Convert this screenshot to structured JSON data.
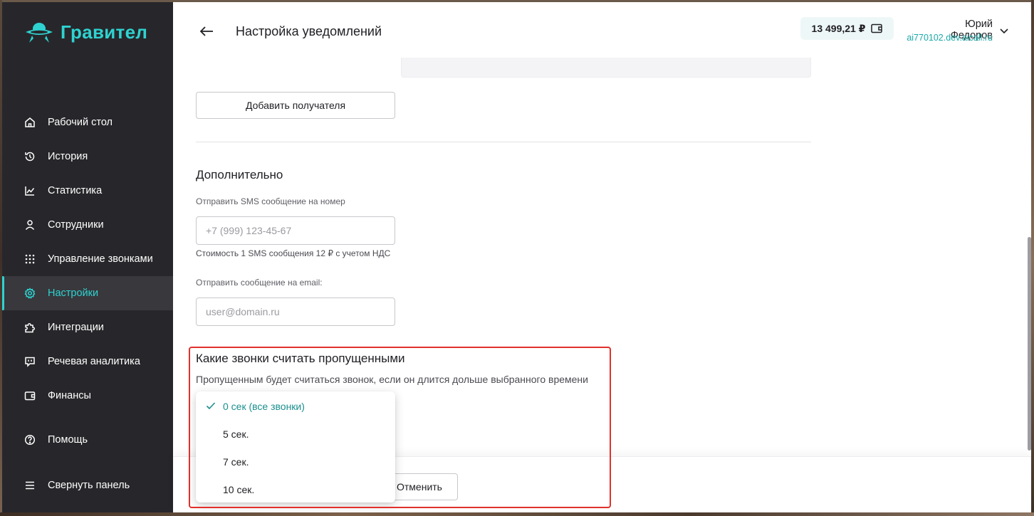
{
  "brand": {
    "name": "Гравител",
    "accent": "#2ed3d0"
  },
  "sidebar": {
    "items": [
      {
        "label": "Рабочий стол",
        "icon": "home-icon"
      },
      {
        "label": "История",
        "icon": "history-icon"
      },
      {
        "label": "Статистика",
        "icon": "chart-icon"
      },
      {
        "label": "Сотрудники",
        "icon": "user-icon"
      },
      {
        "label": "Управление звонками",
        "icon": "grid-icon"
      },
      {
        "label": "Настройки",
        "icon": "gear-icon",
        "active": true
      },
      {
        "label": "Интеграции",
        "icon": "puzzle-icon"
      },
      {
        "label": "Речевая аналитика",
        "icon": "chat-icon"
      },
      {
        "label": "Финансы",
        "icon": "wallet-icon"
      }
    ],
    "help": {
      "label": "Помощь",
      "icon": "question-icon"
    },
    "collapse": {
      "label": "Свернуть панель",
      "icon": "menu-icon"
    }
  },
  "header": {
    "title": "Настройка уведомлений",
    "balance": "13 499,21 ₽",
    "user_name": "Юрий Федоров",
    "user_domain": "ai770102.dev.aicall.ru"
  },
  "recipients": {
    "add_button": "Добавить получателя"
  },
  "additional": {
    "title": "Дополнительно",
    "sms_label": "Отправить SMS сообщение на номер",
    "sms_placeholder": "+7 (999) 123-45-67",
    "sms_hint": "Стоимость 1 SMS сообщения 12 ₽ с учетом НДС",
    "email_label": "Отправить сообщение на email:",
    "email_placeholder": "user@domain.ru"
  },
  "missed": {
    "title": "Какие звонки считать пропущенными",
    "description": "Пропущенным будет считаться звонок, если он длится дольше выбранного времени",
    "options": [
      "0 сек (все звонки)",
      "5 сек.",
      "7 сек.",
      "10 сек."
    ],
    "selected": "0 сек (все звонки)"
  },
  "footer": {
    "cancel": "Отменить"
  }
}
